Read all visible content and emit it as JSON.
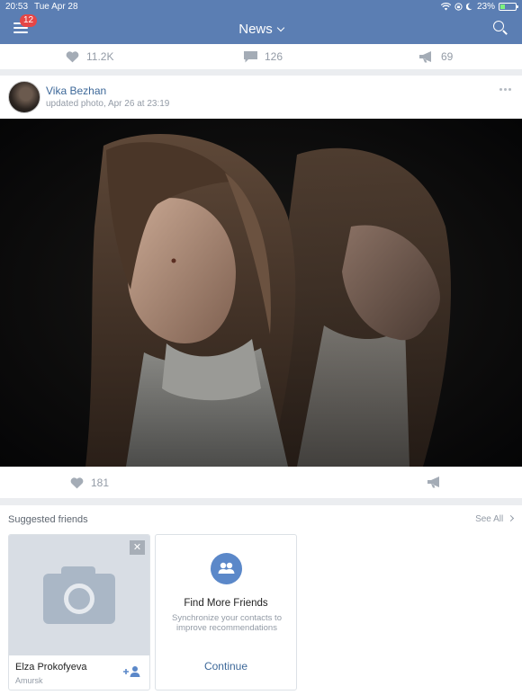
{
  "status_bar": {
    "time": "20:53",
    "date": "Tue Apr 28",
    "battery": "23%",
    "battery_fraction": 0.23
  },
  "header": {
    "title": "News",
    "notifications_badge": "12"
  },
  "prev_post_actions": {
    "likes": "11.2K",
    "comments": "126",
    "shares": "69"
  },
  "post": {
    "author": "Vika Bezhan",
    "meta": "updated photo, Apr 26 at 23:19",
    "likes": "181"
  },
  "suggested": {
    "title": "Suggested friends",
    "see_all": "See All",
    "friend": {
      "name": "Elza Prokofyeva",
      "city": "Amursk"
    },
    "find_more": {
      "title": "Find More Friends",
      "desc": "Synchronize your contacts to improve recommendations",
      "button": "Continue"
    }
  },
  "colors": {
    "header": "#5b7eb3",
    "link": "#3d6899",
    "badge": "#e64646",
    "icon_gray": "#a4acb6"
  }
}
